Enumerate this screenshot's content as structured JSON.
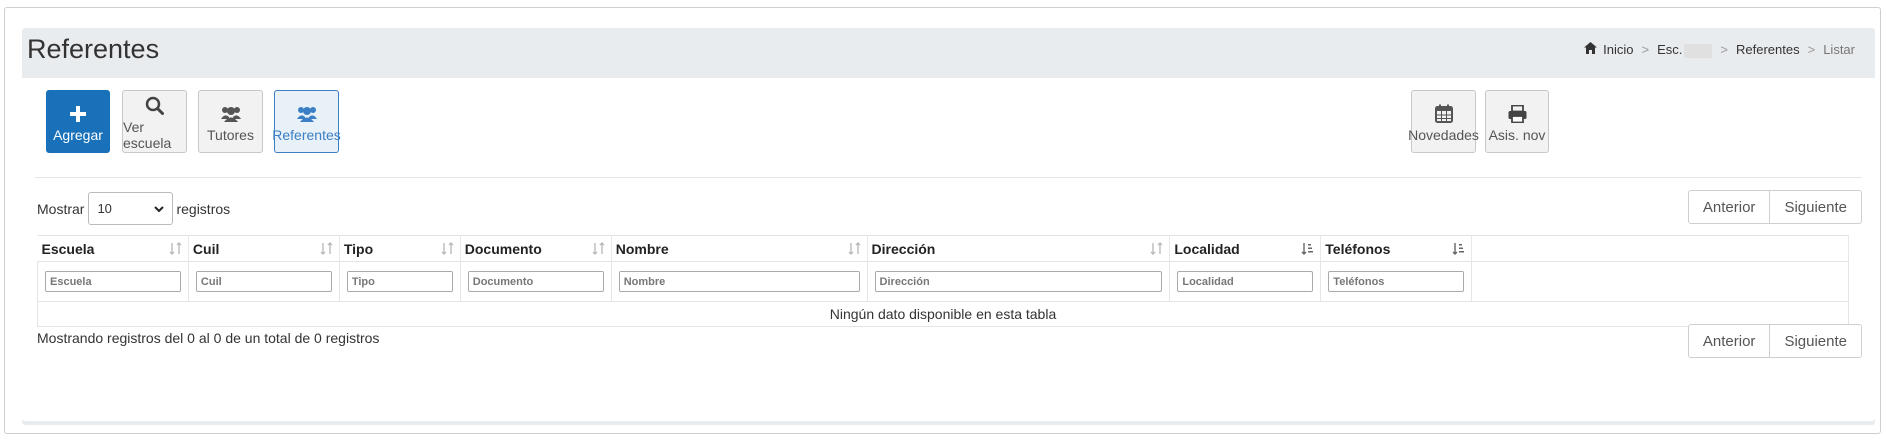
{
  "page": {
    "title": "Referentes"
  },
  "breadcrumb": {
    "items": [
      "Inicio",
      "Esc.",
      "Referentes",
      "Listar"
    ],
    "separator": ">"
  },
  "toolbar": {
    "left": [
      {
        "label": "Agregar",
        "icon": "plus-icon"
      },
      {
        "label": "Ver escuela",
        "icon": "search-icon"
      },
      {
        "label": "Tutores",
        "icon": "users-icon"
      },
      {
        "label": "Referentes",
        "icon": "users-icon"
      }
    ],
    "right": [
      {
        "label": "Novedades",
        "icon": "calendar-icon"
      },
      {
        "label": "Asis. nov",
        "icon": "print-icon"
      }
    ]
  },
  "length": {
    "prefix": "Mostrar",
    "value": "10",
    "suffix": "registros"
  },
  "pager": {
    "prev": "Anterior",
    "next": "Siguiente"
  },
  "table": {
    "columns": [
      "Escuela",
      "Cuil",
      "Tipo",
      "Documento",
      "Nombre",
      "Dirección",
      "Localidad",
      "Teléfonos"
    ],
    "filters": [
      "Escuela",
      "Cuil",
      "Tipo",
      "Documento",
      "Nombre",
      "Dirección",
      "Localidad",
      "Teléfonos"
    ],
    "empty": "Ningún dato disponible en esta tabla"
  },
  "info": "Mostrando registros del 0 al 0 de un total de 0 registros",
  "colors": {
    "primary": "#1871b9",
    "active": "#3b7fc4",
    "panel": "#e9ecef"
  }
}
